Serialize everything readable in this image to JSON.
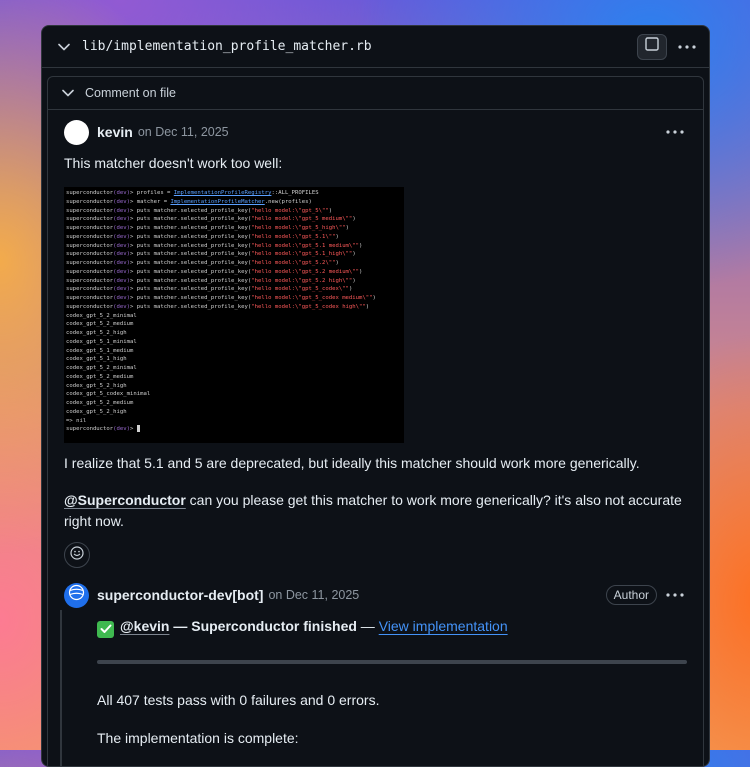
{
  "file": {
    "name": "lib/implementation_profile_matcher.rb"
  },
  "comment_section": {
    "header_label": "Comment on file"
  },
  "comment1": {
    "author": "kevin",
    "date": "on Dec 11, 2025",
    "text1": "This matcher doesn't work too well:",
    "text2": "I realize that 5.1 and 5 are deprecated, but ideally this matcher should work more generically.",
    "mention": "@Superconductor",
    "text3": " can you please get this matcher to work more generically? it's also not accurate right now."
  },
  "terminal": {
    "prompt_name": "superconductor",
    "prompt_env": "(dev)",
    "prompt_arrow": "> ",
    "lines": [
      {
        "code": "profiles = ",
        "const": "ImplementationProfileRegistry",
        "tail": "::ALL_PROFILES",
        "str": "",
        "end": ""
      },
      {
        "code": "matcher = ",
        "const": "ImplementationProfileMatcher",
        "tail": ".new(profiles)",
        "str": "",
        "end": ""
      },
      {
        "code": "puts matcher.selected_profile_key(",
        "const": "",
        "tail": "",
        "str": "\"hello model:\\\"gpt_5\\\"\"",
        "end": ")"
      },
      {
        "code": "puts matcher.selected_profile_key(",
        "const": "",
        "tail": "",
        "str": "\"hello model:\\\"gpt_5 medium\\\"\"",
        "end": ")"
      },
      {
        "code": "puts matcher.selected_profile_key(",
        "const": "",
        "tail": "",
        "str": "\"hello model:\\\"gpt_5_high\\\"\"",
        "end": ")"
      },
      {
        "code": "puts matcher.selected_profile_key(",
        "const": "",
        "tail": "",
        "str": "\"hello model:\\\"gpt_5.1\\\"\"",
        "end": ")"
      },
      {
        "code": "puts matcher.selected_profile_key(",
        "const": "",
        "tail": "",
        "str": "\"hello model:\\\"gpt_5.1 medium\\\"\"",
        "end": ")"
      },
      {
        "code": "puts matcher.selected_profile_key(",
        "const": "",
        "tail": "",
        "str": "\"hello model:\\\"gpt_5.1_high\\\"\"",
        "end": ")"
      },
      {
        "code": "puts matcher.selected_profile_key(",
        "const": "",
        "tail": "",
        "str": "\"hello model:\\\"gpt_5.2\\\"\"",
        "end": ")"
      },
      {
        "code": "puts matcher.selected_profile_key(",
        "const": "",
        "tail": "",
        "str": "\"hello model:\\\"gpt_5.2 medium\\\"\"",
        "end": ")"
      },
      {
        "code": "puts matcher.selected_profile_key(",
        "const": "",
        "tail": "",
        "str": "\"hello model:\\\"gpt_5.2 high\\\"\"",
        "end": ")"
      },
      {
        "code": "puts matcher.selected_profile_key(",
        "const": "",
        "tail": "",
        "str": "\"hello model:\\\"gpt_5_codex\\\"\"",
        "end": ")"
      },
      {
        "code": "puts matcher.selected_profile_key(",
        "const": "",
        "tail": "",
        "str": "\"hello model:\\\"gpt_5_codex medium\\\"\"",
        "end": ")"
      },
      {
        "code": "puts matcher.selected_profile_key(",
        "const": "",
        "tail": "",
        "str": "\"hello model:\\\"gpt_5_codex high\\\"\"",
        "end": ")"
      }
    ],
    "output": [
      "codex_gpt_5_2_minimal",
      "codex_gpt_5_2_medium",
      "codex_gpt_5_2_high",
      "codex_gpt_5_1_minimal",
      "codex_gpt_5_1_medium",
      "codex_gpt_5_1_high",
      "codex_gpt_5_2_minimal",
      "codex_gpt_5_2_medium",
      "codex_gpt_5_2_high",
      "codex_gpt_5_codex_minimal",
      "codex_gpt_5_2_medium",
      "codex_gpt_5_2_high",
      "=> nil"
    ]
  },
  "comment2": {
    "author": "superconductor-dev[bot]",
    "date": "on Dec 11, 2025",
    "badge": "Author",
    "check_emoji": "✅",
    "mention": "@kevin",
    "dash1": " — ",
    "status": "Superconductor finished",
    "dash2": " — ",
    "link": "View implementation",
    "line1": "All 407 tests pass with 0 failures and 0 errors.",
    "line2": "The implementation is complete:"
  },
  "icons": {
    "collapse": "chevron-down-icon",
    "view": "square-icon",
    "menu": "kebab-horizontal-icon",
    "reaction": "smiley-icon",
    "bot": "globe-icon",
    "check": "check-mark-icon"
  },
  "colors": {
    "background": "#0d1117",
    "border": "#30363d",
    "text": "#e6edf3",
    "muted": "#8d96a0",
    "link": "#4493f8",
    "bot_avatar": "#1f6feb"
  }
}
